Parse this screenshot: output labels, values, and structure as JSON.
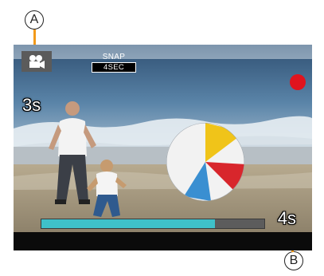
{
  "callouts": {
    "a": "A",
    "b": "B"
  },
  "screen": {
    "mode_icon": "movie-camera-icon",
    "snap_title": "SNAP",
    "snap_value": "4SEC",
    "elapsed": "3s",
    "total": "4s",
    "progress_fraction": 0.78,
    "recording_indicator": "red-record-dot"
  },
  "colors": {
    "progress": "#3fc1c9",
    "record": "#e0141e",
    "callout_leader": "#f29a1a"
  }
}
